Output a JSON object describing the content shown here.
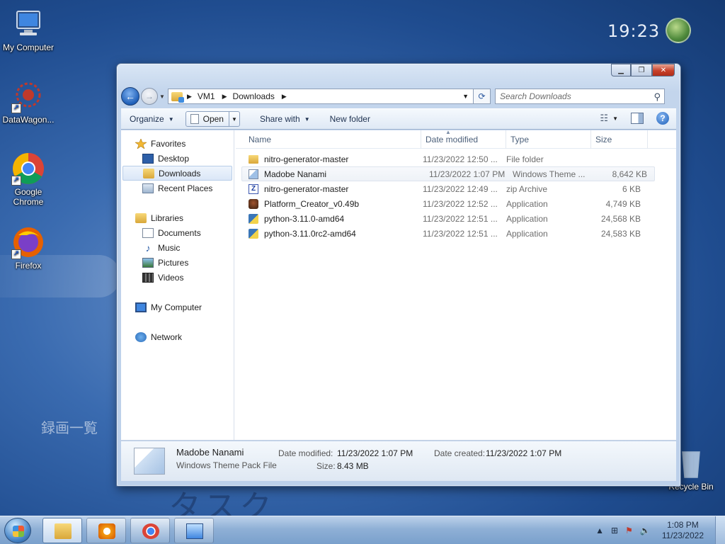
{
  "desktop": {
    "clock_big": "19:23",
    "overlay_text": "録画一覧",
    "overlay_text2": "タスク",
    "icons": [
      {
        "label": "My Computer"
      },
      {
        "label": "DataWagon..."
      },
      {
        "label": "Google Chrome"
      },
      {
        "label": "Firefox"
      },
      {
        "label": "Recycle Bin"
      }
    ]
  },
  "window": {
    "address": {
      "segments": [
        "VM1",
        "Downloads"
      ]
    },
    "search": {
      "placeholder": "Search Downloads"
    },
    "toolbar": {
      "organize": "Organize",
      "open": "Open",
      "share_with": "Share with",
      "new_folder": "New folder"
    },
    "nav": {
      "favorites": "Favorites",
      "desktop": "Desktop",
      "downloads": "Downloads",
      "recent_places": "Recent Places",
      "libraries": "Libraries",
      "documents": "Documents",
      "music": "Music",
      "pictures": "Pictures",
      "videos": "Videos",
      "my_computer": "My Computer",
      "network": "Network"
    },
    "columns": {
      "name": "Name",
      "date": "Date modified",
      "type": "Type",
      "size": "Size"
    },
    "files": [
      {
        "name": "nitro-generator-master",
        "date": "11/23/2022 12:50 ...",
        "type": "File folder",
        "size": "",
        "icon": "folder-icon"
      },
      {
        "name": "Madobe Nanami",
        "date": "11/23/2022 1:07 PM",
        "type": "Windows Theme ...",
        "size": "8,642 KB",
        "icon": "theme-file-icon"
      },
      {
        "name": "nitro-generator-master",
        "date": "11/23/2022 12:49 ...",
        "type": "zip Archive",
        "size": "6 KB",
        "icon": "zip-file-icon"
      },
      {
        "name": "Platform_Creator_v0.49b",
        "date": "11/23/2022 12:52 ...",
        "type": "Application",
        "size": "4,749 KB",
        "icon": "app-icon"
      },
      {
        "name": "python-3.11.0-amd64",
        "date": "11/23/2022 12:51 ...",
        "type": "Application",
        "size": "24,568 KB",
        "icon": "installer-icon"
      },
      {
        "name": "python-3.11.0rc2-amd64",
        "date": "11/23/2022 12:51 ...",
        "type": "Application",
        "size": "24,583 KB",
        "icon": "installer-icon"
      }
    ],
    "details": {
      "name": "Madobe Nanami",
      "type": "Windows Theme Pack File",
      "date_modified_label": "Date modified:",
      "date_modified": "11/23/2022 1:07 PM",
      "size_label": "Size:",
      "size": "8.43 MB",
      "date_created_label": "Date created:",
      "date_created": "11/23/2022 1:07 PM"
    }
  },
  "taskbar": {
    "time": "1:08 PM",
    "date": "11/23/2022"
  },
  "colors": {
    "accent": "#1f5fb8",
    "close": "#c8412a"
  }
}
